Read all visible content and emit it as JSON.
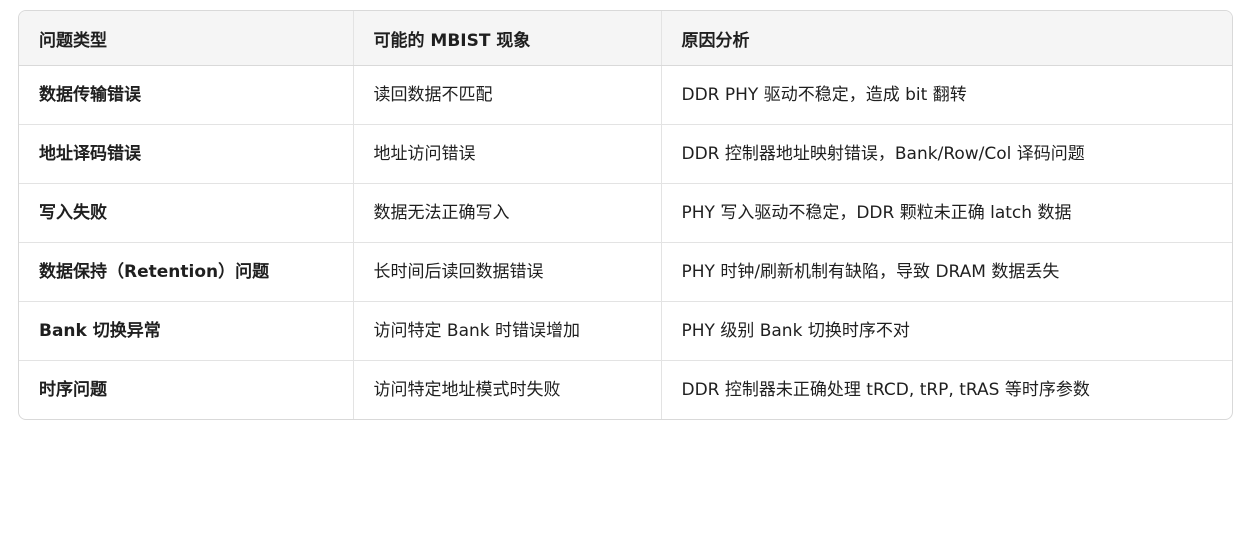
{
  "table": {
    "headers": [
      "问题类型",
      "可能的 MBIST 现象",
      "原因分析"
    ],
    "rows": [
      {
        "type": "数据传输错误",
        "phenomenon": "读回数据不匹配",
        "cause": "DDR PHY 驱动不稳定，造成 bit 翻转"
      },
      {
        "type": "地址译码错误",
        "phenomenon": "地址访问错误",
        "cause": "DDR 控制器地址映射错误，Bank/Row/Col 译码问题"
      },
      {
        "type": "写入失败",
        "phenomenon": "数据无法正确写入",
        "cause": "PHY 写入驱动不稳定，DDR 颗粒未正确 latch 数据"
      },
      {
        "type": "数据保持（Retention）问题",
        "phenomenon": "长时间后读回数据错误",
        "cause": "PHY 时钟/刷新机制有缺陷，导致 DRAM 数据丢失"
      },
      {
        "type": "Bank 切换异常",
        "phenomenon": "访问特定 Bank 时错误增加",
        "cause": "PHY 级别 Bank 切换时序不对"
      },
      {
        "type": "时序问题",
        "phenomenon": "访问特定地址模式时失败",
        "cause": "DDR 控制器未正确处理 tRCD, tRP, tRAS 等时序参数"
      }
    ]
  }
}
